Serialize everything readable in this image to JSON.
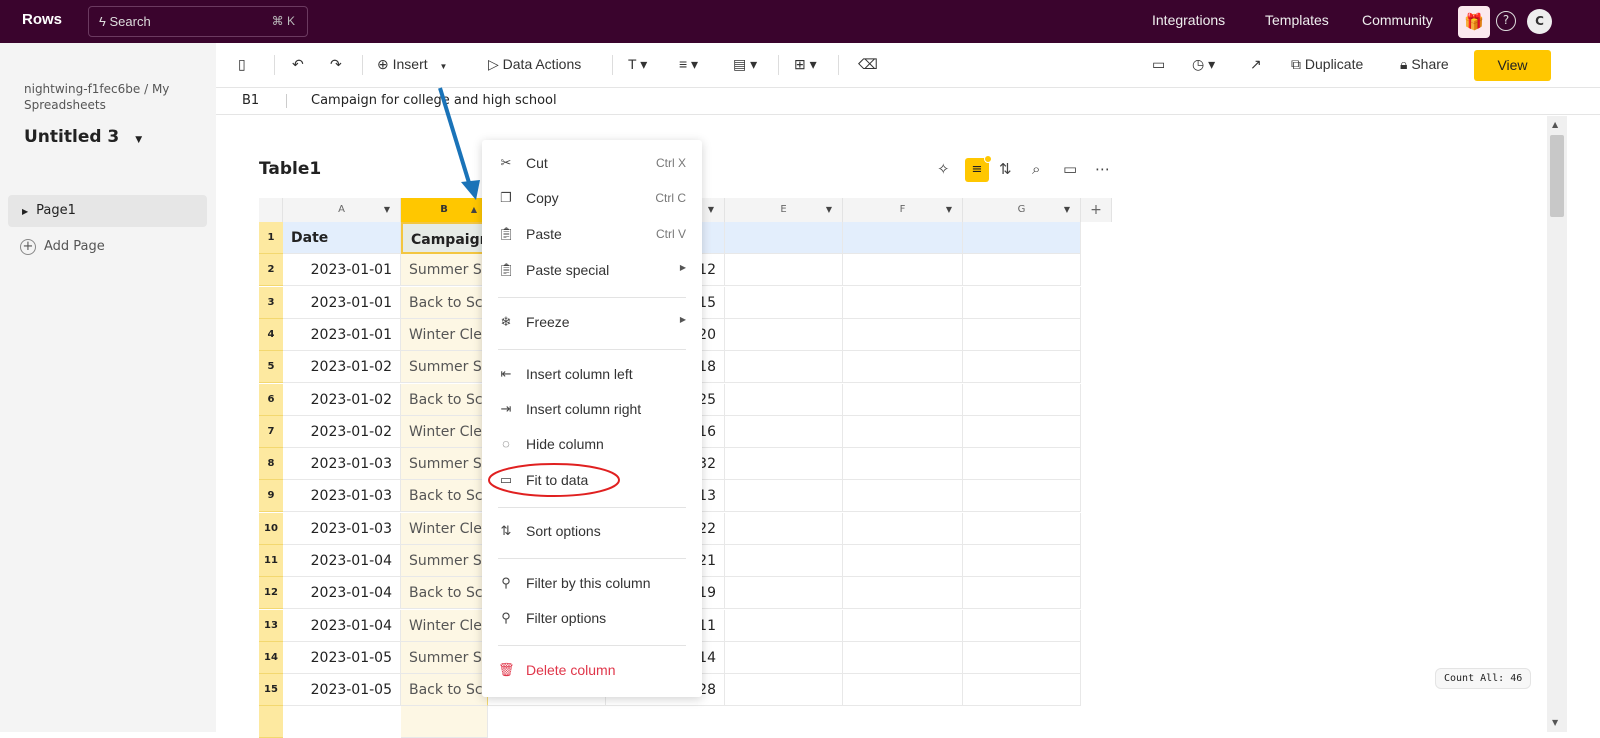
{
  "topbar": {
    "logo": "Rows",
    "search_label": "Search",
    "search_shortcut": "⌘ K",
    "links": [
      "Integrations",
      "Templates",
      "Community"
    ],
    "avatar": "C"
  },
  "sidebar": {
    "breadcrumb": "nightwing-f1fec6be / My Spreadsheets",
    "doc_title": "Untitled 3",
    "pages": [
      "Page1"
    ],
    "add_page": "Add Page"
  },
  "toolbar": {
    "insert": "Insert",
    "data_actions": "Data Actions",
    "duplicate": "Duplicate",
    "share": "Share",
    "view": "View"
  },
  "formula_bar": {
    "cell_ref": "B1",
    "value": "Campaign for college and high school"
  },
  "table": {
    "title": "Table1",
    "columns": [
      "A",
      "B",
      "",
      "",
      "E",
      "F",
      "G"
    ],
    "headers": [
      "Date",
      "Campaign"
    ],
    "rows": [
      [
        "2023-01-01",
        "Summer S",
        "12"
      ],
      [
        "2023-01-01",
        "Back to Sc",
        "15"
      ],
      [
        "2023-01-01",
        "Winter Cle",
        "20"
      ],
      [
        "2023-01-02",
        "Summer S",
        "18"
      ],
      [
        "2023-01-02",
        "Back to Sc",
        "25"
      ],
      [
        "2023-01-02",
        "Winter Cle",
        "16"
      ],
      [
        "2023-01-03",
        "Summer S",
        "32"
      ],
      [
        "2023-01-03",
        "Back to Sc",
        "13"
      ],
      [
        "2023-01-03",
        "Winter Cle",
        "22"
      ],
      [
        "2023-01-04",
        "Summer S",
        "21"
      ],
      [
        "2023-01-04",
        "Back to Sc",
        "19"
      ],
      [
        "2023-01-04",
        "Winter Cle",
        "11"
      ],
      [
        "2023-01-05",
        "Summer S",
        "14"
      ],
      [
        "2023-01-05",
        "Back to Sc",
        "28"
      ]
    ]
  },
  "context_menu": {
    "items": [
      {
        "label": "Cut",
        "shortcut": "Ctrl X",
        "icon": "scissors-icon"
      },
      {
        "label": "Copy",
        "shortcut": "Ctrl C",
        "icon": "copy-icon"
      },
      {
        "label": "Paste",
        "shortcut": "Ctrl V",
        "icon": "clipboard-icon"
      },
      {
        "label": "Paste special",
        "icon": "clipboard-icon"
      },
      {
        "label": "Freeze",
        "icon": "snowflake-icon"
      },
      {
        "label": "Insert column left",
        "icon": "insert-left-icon"
      },
      {
        "label": "Insert column right",
        "icon": "insert-right-icon"
      },
      {
        "label": "Hide column",
        "icon": "eye-off-icon"
      },
      {
        "label": "Fit to data",
        "icon": "fit-icon"
      },
      {
        "label": "Sort options",
        "icon": "sort-icon"
      },
      {
        "label": "Filter by this column",
        "icon": "filter-icon"
      },
      {
        "label": "Filter options",
        "icon": "filter-icon"
      },
      {
        "label": "Delete column",
        "icon": "trash-icon"
      }
    ]
  },
  "status": {
    "count": "Count All: 46"
  },
  "colors": {
    "topbar": "#3a042d",
    "accent": "#ffc700",
    "annotation_arrow": "#1a73b8",
    "annotation_circle": "#e02020",
    "delete": "#e0364a"
  }
}
